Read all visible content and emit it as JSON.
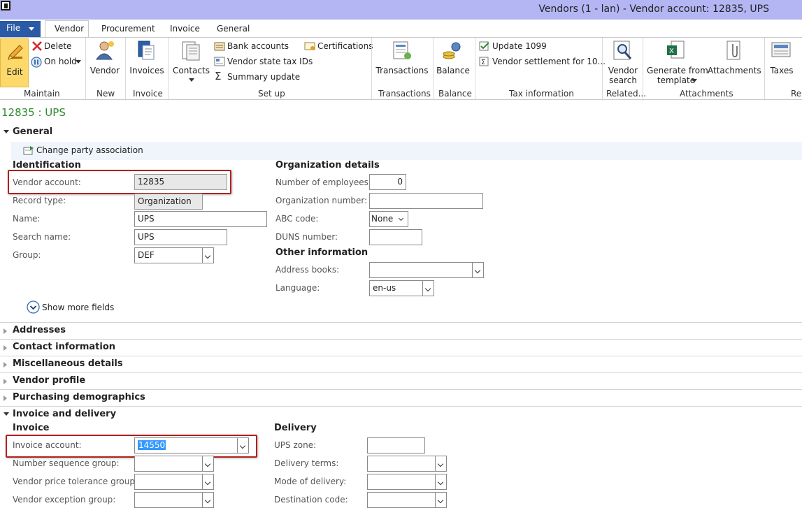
{
  "window": {
    "title": "Vendors (1 - lan) - Vendor account: 12835, UPS"
  },
  "tabs": {
    "file": "File",
    "vendor": "Vendor",
    "procurement": "Procurement",
    "invoice": "Invoice",
    "general": "General"
  },
  "ribbon": {
    "edit": "Edit",
    "delete": "Delete",
    "on_hold": "On hold",
    "vendor": "Vendor",
    "invoices": "Invoices",
    "contacts": "Contacts",
    "bank_accounts": "Bank accounts",
    "vendor_state_tax_ids": "Vendor state tax IDs",
    "summary_update": "Summary update",
    "certifications": "Certifications",
    "transactions": "Transactions",
    "balance": "Balance",
    "update_1099": "Update 1099",
    "vendor_settlement": "Vendor settlement for 10...",
    "vendor_search_line1": "Vendor",
    "vendor_search_line2": "search",
    "generate_line1": "Generate from",
    "generate_line2": "template",
    "attachments": "Attachments",
    "taxes": "Taxes",
    "groups": {
      "maintain": "Maintain",
      "new": "New",
      "invoice": "Invoice",
      "setup": "Set up",
      "transactions": "Transactions",
      "balance": "Balance",
      "tax_information": "Tax information",
      "related": "Related...",
      "attachments": "Attachments",
      "cut": "Re"
    }
  },
  "record_title": "12835 : UPS",
  "general": {
    "title": "General",
    "change_party": "Change party association",
    "identification": {
      "title": "Identification",
      "vendor_account_label": "Vendor account:",
      "vendor_account": "12835",
      "record_type_label": "Record type:",
      "record_type": "Organization",
      "name_label": "Name:",
      "name": "UPS",
      "search_name_label": "Search name:",
      "search_name": "UPS",
      "group_label": "Group:",
      "group": "DEF"
    },
    "organization_details": {
      "title": "Organization details",
      "employees_label": "Number of employees:",
      "employees": "0",
      "org_number_label": "Organization number:",
      "org_number": "",
      "abc_label": "ABC code:",
      "abc": "None",
      "duns_label": "DUNS number:",
      "duns": ""
    },
    "other_information": {
      "title": "Other information",
      "address_books_label": "Address books:",
      "address_books": "",
      "language_label": "Language:",
      "language": "en-us"
    },
    "show_more": "Show more fields"
  },
  "sections": {
    "addresses": "Addresses",
    "contact_information": "Contact information",
    "miscellaneous": "Miscellaneous details",
    "vendor_profile": "Vendor profile",
    "purchasing_demographics": "Purchasing demographics",
    "invoice_and_delivery": "Invoice and delivery"
  },
  "invoice": {
    "title": "Invoice",
    "invoice_account_label": "Invoice account:",
    "invoice_account": "14550",
    "number_sequence_label": "Number sequence group:",
    "price_tolerance_label": "Vendor price tolerance group:",
    "exception_label": "Vendor exception group:"
  },
  "delivery": {
    "title": "Delivery",
    "ups_zone_label": "UPS zone:",
    "delivery_terms_label": "Delivery terms:",
    "mode_label": "Mode of delivery:",
    "destination_label": "Destination code:"
  }
}
